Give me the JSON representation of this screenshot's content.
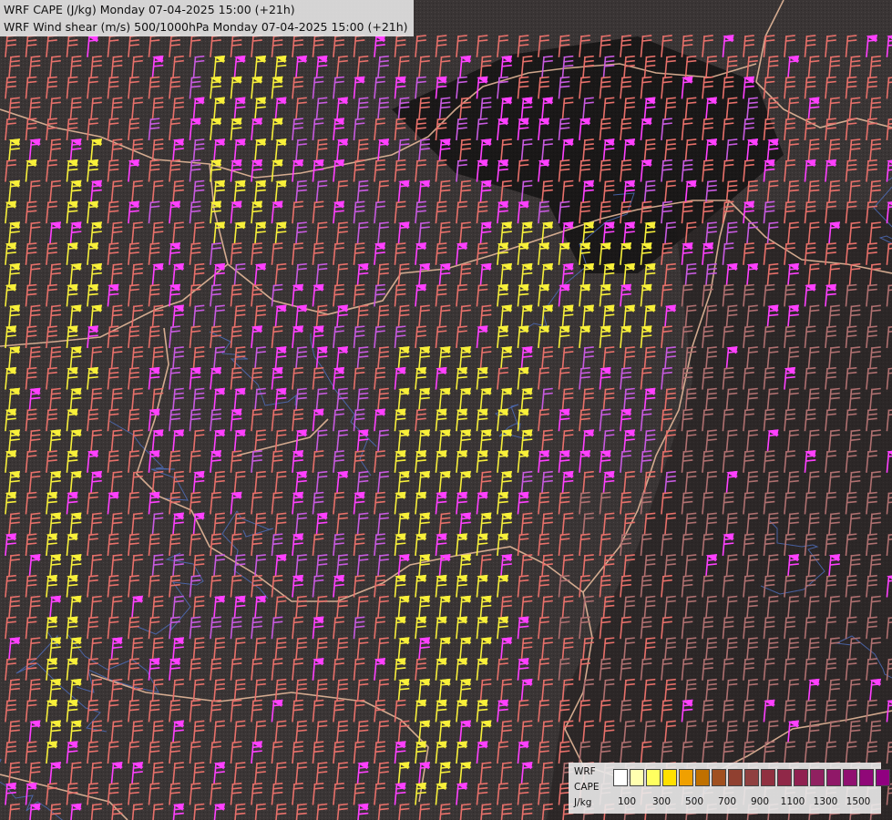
{
  "header": {
    "line1": "WRF CAPE (J/kg) Monday 07-04-2025 15:00 (+21h)",
    "line2": "WRF Wind shear (m/s) 500/1000hPa Monday 07-04-2025 15:00 (+21h)"
  },
  "legend": {
    "labels": [
      "WRF",
      "CAPE",
      "J/kg"
    ],
    "swatch_colors": [
      "#ffffff",
      "#ffffb0",
      "#ffff60",
      "#ffe000",
      "#f0a000",
      "#c07000",
      "#a05020",
      "#904030",
      "#904040",
      "#903040",
      "#902848",
      "#902050",
      "#902060",
      "#901868",
      "#901070",
      "#900878",
      "#900080"
    ],
    "ticks": [
      "100",
      "300",
      "500",
      "700",
      "900",
      "1100",
      "1300",
      "1500"
    ]
  },
  "colors": {
    "background": "#3a3535",
    "shear_low": "#e8706a",
    "shear_mid": "#c85ae0",
    "shear_high": "#ff40ff",
    "shear_yellow": "#f8f03a",
    "shear_dark": "#b07070",
    "borders": "#f0c0a0",
    "rivers": "#5070c0"
  },
  "icons": {
    "barb": "wind-barb-icon"
  }
}
